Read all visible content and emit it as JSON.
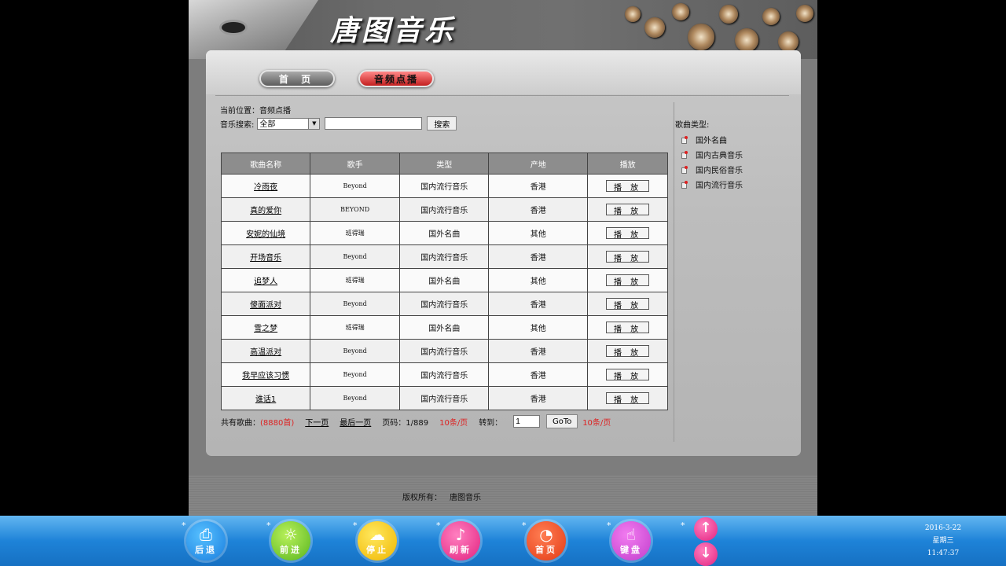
{
  "header": {
    "logo_text": "唐图音乐",
    "nav": [
      {
        "label": "首 页"
      },
      {
        "label": "音频点播"
      }
    ]
  },
  "content": {
    "location_label": "当前位置：",
    "location_value": "音频点播",
    "search": {
      "label": "音乐搜索:",
      "select_value": "全部",
      "input_value": "",
      "button_label": "搜索"
    },
    "table": {
      "headers": [
        "歌曲名称",
        "歌手",
        "类型",
        "产地",
        "播放"
      ],
      "play_label": "播 放",
      "rows": [
        {
          "song": "冷雨夜",
          "singer": "Beyond",
          "type": "国内流行音乐",
          "origin": "香港"
        },
        {
          "song": "真的爱你",
          "singer": "BEYOND",
          "type": "国内流行音乐",
          "origin": "香港"
        },
        {
          "song": "安妮的仙境",
          "singer": "班得瑞",
          "type": "国外名曲",
          "origin": "其他"
        },
        {
          "song": "开场音乐",
          "singer": "Beyond",
          "type": "国内流行音乐",
          "origin": "香港"
        },
        {
          "song": "追梦人",
          "singer": "班得瑞",
          "type": "国外名曲",
          "origin": "其他"
        },
        {
          "song": "傻面派对",
          "singer": "Beyond",
          "type": "国内流行音乐",
          "origin": "香港"
        },
        {
          "song": "雪之梦",
          "singer": "班得瑞",
          "type": "国外名曲",
          "origin": "其他"
        },
        {
          "song": "高温派对",
          "singer": "Beyond",
          "type": "国内流行音乐",
          "origin": "香港"
        },
        {
          "song": "我早应该习惯",
          "singer": "Beyond",
          "type": "国内流行音乐",
          "origin": "香港"
        },
        {
          "song": "谁话1",
          "singer": "Beyond",
          "type": "国内流行音乐",
          "origin": "香港"
        }
      ]
    },
    "pager": {
      "total_label": "共有歌曲：",
      "total_value": "(8880首)",
      "next": "下一页",
      "last": "最后一页",
      "page_info": "页码：1/889",
      "per_page_1": "10条/页",
      "goto_label": "转到：",
      "goto_value": "1",
      "goto_button": "GoTo",
      "per_page_2": "10条/页"
    }
  },
  "sidebar": {
    "title": "歌曲类型:",
    "genres": [
      "国外名曲",
      "国内古典音乐",
      "国内民俗音乐",
      "国内流行音乐"
    ]
  },
  "footer": {
    "copyright_label": "版权所有：",
    "copyright_value": "唐图音乐"
  },
  "taskbar": {
    "buttons": [
      {
        "label": "后退",
        "icon": "printer-icon"
      },
      {
        "label": "前进",
        "icon": "sun-icon"
      },
      {
        "label": "停止",
        "icon": "cloud-icon"
      },
      {
        "label": "刷新",
        "icon": "sound-wave-icon"
      },
      {
        "label": "首页",
        "icon": "ear-icon"
      },
      {
        "label": "键盘",
        "icon": "keyboard-hand-icon"
      }
    ],
    "scroll_up_icon": "arrow-up-icon",
    "scroll_down_icon": "arrow-down-icon",
    "clock": {
      "date": "2016-3-22",
      "weekday": "星期三",
      "time": "11:47:37"
    }
  },
  "colors": {
    "accent_red": "#dd2222",
    "taskbar_blue": "#1e83d8",
    "table_header": "#8d8d8d"
  }
}
